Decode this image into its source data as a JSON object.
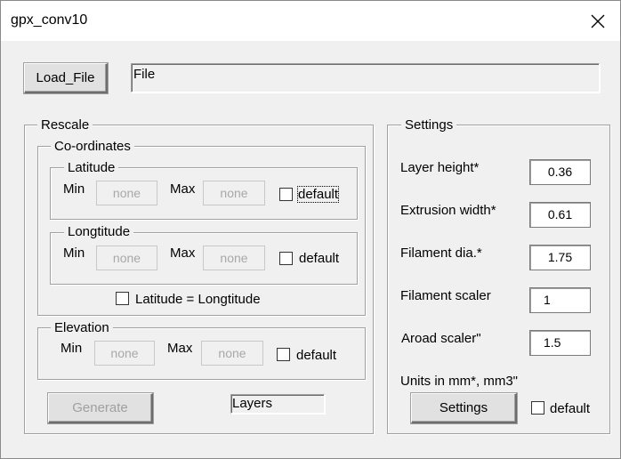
{
  "window": {
    "title": "gpx_conv10",
    "close_icon": "close-icon"
  },
  "top": {
    "load_button": "Load_File",
    "file_field": "File"
  },
  "rescale": {
    "legend": "Rescale",
    "coords_legend": "Co-ordinates",
    "latitude": {
      "legend": "Latitude",
      "min_label": "Min",
      "max_label": "Max",
      "min_value": "none",
      "max_value": "none",
      "default_label": "default",
      "default_checked": false
    },
    "longtitude": {
      "legend": "Longtitude",
      "min_label": "Min",
      "max_label": "Max",
      "min_value": "none",
      "max_value": "none",
      "default_label": "default",
      "default_checked": false
    },
    "lat_eq_long": {
      "label": "Latitude = Longtitude",
      "checked": false
    },
    "elevation": {
      "legend": "Elevation",
      "min_label": "Min",
      "max_label": "Max",
      "min_value": "none",
      "max_value": "none",
      "default_label": "default",
      "default_checked": false
    },
    "generate_button": "Generate",
    "layers_field": "Layers"
  },
  "settings": {
    "legend": "Settings",
    "layer_height": {
      "label": "Layer height*",
      "value": "0.36"
    },
    "extrusion_width": {
      "label": "Extrusion width*",
      "value": "0.61"
    },
    "filament_dia": {
      "label": "Filament dia.*",
      "value": "1.75"
    },
    "filament_scaler": {
      "label": "Filament scaler",
      "value": "1"
    },
    "aroad_scaler": {
      "label": "Aroad scaler\"",
      "value": "1.5"
    },
    "units_note": "Units in mm*, mm3\"",
    "settings_button": "Settings",
    "default_label": "default",
    "default_checked": false
  }
}
